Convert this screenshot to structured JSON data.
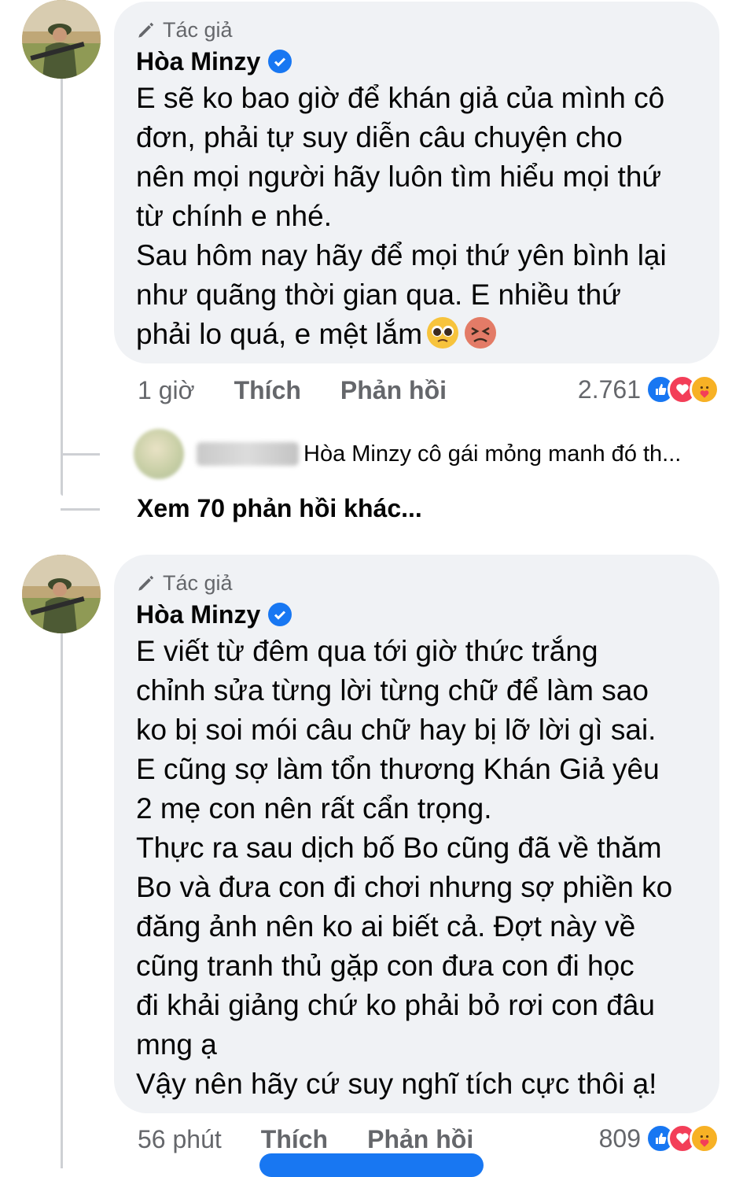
{
  "comments": [
    {
      "author_badge": "Tác giả",
      "author_name": "Hòa Minzy",
      "text": "E sẽ ko bao giờ để khán giả của mình cô\nđơn, phải tự suy diễn câu chuyện cho\nnên mọi người hãy luôn tìm hiểu mọi thứ\ntừ chính e nhé.\nSau hôm nay hãy để mọi thứ yên bình lại\nnhư quãng thời gian qua. E nhiều thứ\nphải lo quá, e mệt lắm",
      "time": "1 giờ",
      "like_label": "Thích",
      "reply_label": "Phản hồi",
      "reaction_count": "2.761",
      "emojis": [
        "pleading-face-emoji",
        "tired-face-emoji"
      ]
    },
    {
      "author_badge": "Tác giả",
      "author_name": "Hòa Minzy",
      "text": "E viết từ đêm qua tới giờ thức trắng\nchỉnh sửa từng lời từng chữ để làm sao\nko bị soi mói câu chữ hay bị lỡ lời gì sai.\nE cũng sợ làm tổn thương Khán Giả yêu\n2 mẹ con nên rất cẩn trọng.\nThực ra sau dịch bố Bo cũng đã về thăm\nBo và đưa con đi chơi nhưng sợ phiền ko\nđăng ảnh nên ko ai biết cả. Đợt này về\ncũng tranh thủ gặp con đưa con đi học\nđi khải giảng chứ ko phải bỏ rơi con đâu\nmng ạ\nVậy nên hãy cứ suy nghĩ tích cực thôi ạ!",
      "time": "56 phút",
      "like_label": "Thích",
      "reply_label": "Phản hồi",
      "reaction_count": "809"
    }
  ],
  "reply_preview": {
    "text": "Hòa Minzy cô gái mỏng manh đó th..."
  },
  "more_replies": "Xem 70 phản hồi khác...",
  "reaction_icons": [
    "like-icon",
    "love-icon",
    "care-icon"
  ],
  "colors": {
    "bubble": "#f0f2f5",
    "meta_text": "#65676b",
    "like_blue": "#1877f2",
    "love_red": "#f33e58",
    "care_yellow": "#f7b125"
  }
}
